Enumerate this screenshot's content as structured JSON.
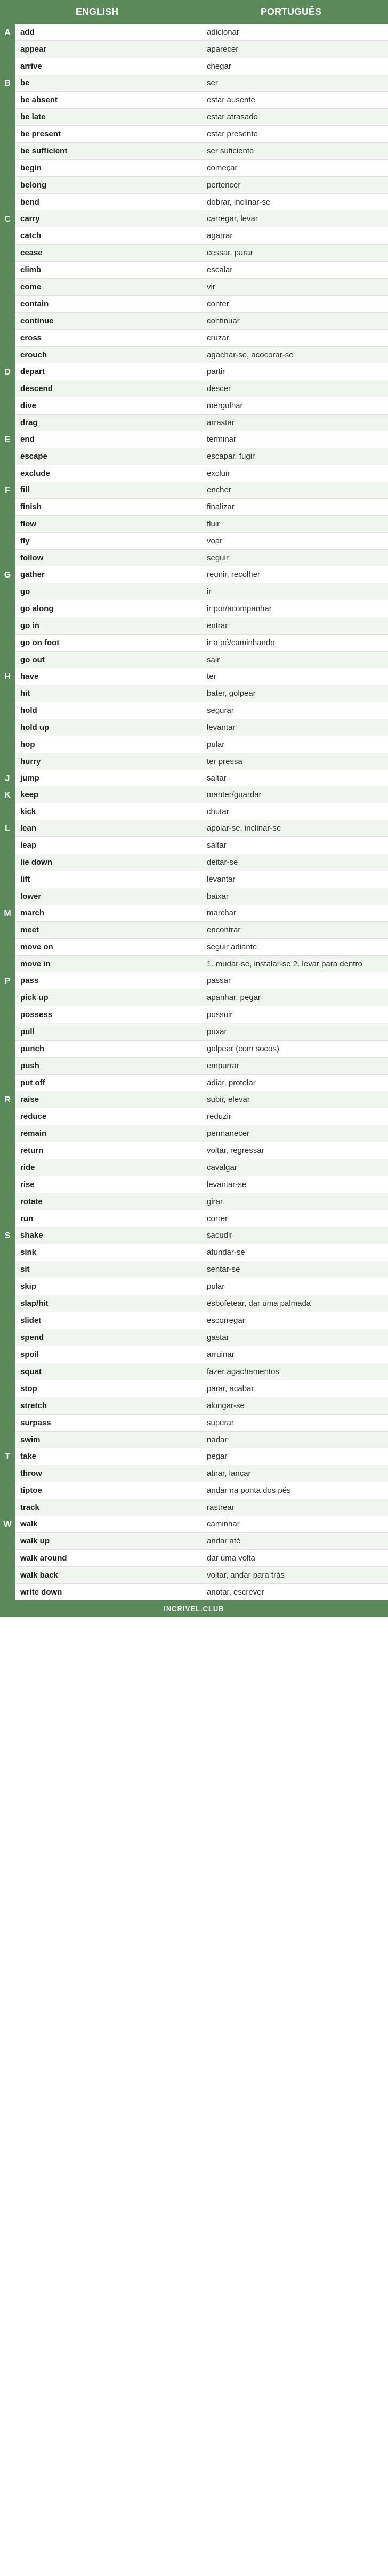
{
  "header": {
    "english": "ENGLISH",
    "portuguese": "PORTUGUÊS"
  },
  "sections": [
    {
      "letter": "A",
      "entries": [
        {
          "en": "add",
          "pt": "adicionar"
        },
        {
          "en": "appear",
          "pt": "aparecer"
        },
        {
          "en": "arrive",
          "pt": "chegar"
        }
      ]
    },
    {
      "letter": "B",
      "entries": [
        {
          "en": "be",
          "pt": "ser"
        },
        {
          "en": "be absent",
          "pt": "estar ausente"
        },
        {
          "en": "be late",
          "pt": "estar atrasado"
        },
        {
          "en": "be present",
          "pt": "estar presente"
        },
        {
          "en": "be sufficient",
          "pt": "ser suficiente"
        },
        {
          "en": "begin",
          "pt": "começar"
        },
        {
          "en": "belong",
          "pt": "pertencer"
        },
        {
          "en": "bend",
          "pt": "dobrar, inclinar-se"
        }
      ]
    },
    {
      "letter": "C",
      "entries": [
        {
          "en": "carry",
          "pt": "carregar, levar"
        },
        {
          "en": "catch",
          "pt": "agarrar"
        },
        {
          "en": "cease",
          "pt": "cessar, parar"
        },
        {
          "en": "climb",
          "pt": "escalar"
        },
        {
          "en": "come",
          "pt": "vir"
        },
        {
          "en": "contain",
          "pt": "conter"
        },
        {
          "en": "continue",
          "pt": "continuar"
        },
        {
          "en": "cross",
          "pt": "cruzar"
        },
        {
          "en": "crouch",
          "pt": "agachar-se, acocorar-se"
        }
      ]
    },
    {
      "letter": "D",
      "entries": [
        {
          "en": "depart",
          "pt": "partir"
        },
        {
          "en": "descend",
          "pt": "descer"
        },
        {
          "en": "dive",
          "pt": "mergulhar"
        },
        {
          "en": "drag",
          "pt": "arrastar"
        }
      ]
    },
    {
      "letter": "E",
      "entries": [
        {
          "en": "end",
          "pt": "terminar"
        },
        {
          "en": "escape",
          "pt": "escapar, fugir"
        },
        {
          "en": "exclude",
          "pt": "excluir"
        }
      ]
    },
    {
      "letter": "F",
      "entries": [
        {
          "en": "fill",
          "pt": "encher"
        },
        {
          "en": "finish",
          "pt": "finalizar"
        },
        {
          "en": "flow",
          "pt": "fluir"
        },
        {
          "en": "fly",
          "pt": "voar"
        },
        {
          "en": "follow",
          "pt": "seguir"
        }
      ]
    },
    {
      "letter": "G",
      "entries": [
        {
          "en": "gather",
          "pt": "reunir, recolher"
        },
        {
          "en": "go",
          "pt": "ir"
        },
        {
          "en": "go along",
          "pt": "ir por/acompanhar"
        },
        {
          "en": "go in",
          "pt": "entrar"
        },
        {
          "en": "go on foot",
          "pt": "ir a pé/caminhando"
        },
        {
          "en": "go out",
          "pt": "sair"
        }
      ]
    },
    {
      "letter": "H",
      "entries": [
        {
          "en": "have",
          "pt": "ter"
        },
        {
          "en": "hit",
          "pt": "bater, golpear"
        },
        {
          "en": "hold",
          "pt": "segurar"
        },
        {
          "en": "hold up",
          "pt": "levantar"
        },
        {
          "en": "hop",
          "pt": "pular"
        },
        {
          "en": "hurry",
          "pt": "ter pressa"
        }
      ]
    },
    {
      "letter": "J",
      "entries": [
        {
          "en": "jump",
          "pt": "saltar"
        }
      ]
    },
    {
      "letter": "K",
      "entries": [
        {
          "en": "keep",
          "pt": "manter/guardar"
        },
        {
          "en": "kick",
          "pt": "chutar"
        }
      ]
    },
    {
      "letter": "L",
      "entries": [
        {
          "en": "lean",
          "pt": "apoiar-se, inclinar-se"
        },
        {
          "en": "leap",
          "pt": "saltar"
        },
        {
          "en": "lie down",
          "pt": "deitar-se"
        },
        {
          "en": "lift",
          "pt": "levantar"
        },
        {
          "en": "lower",
          "pt": "baixar"
        }
      ]
    },
    {
      "letter": "M",
      "entries": [
        {
          "en": "march",
          "pt": "marchar"
        },
        {
          "en": "meet",
          "pt": "encontrar"
        },
        {
          "en": "move on",
          "pt": "seguir adiante"
        },
        {
          "en": "move in",
          "pt": "1. mudar-se, instalar-se\n2. levar para dentro"
        }
      ]
    },
    {
      "letter": "P",
      "entries": [
        {
          "en": "pass",
          "pt": "passar"
        },
        {
          "en": "pick up",
          "pt": "apanhar, pegar"
        },
        {
          "en": "possess",
          "pt": "possuir"
        },
        {
          "en": "pull",
          "pt": "puxar"
        },
        {
          "en": "punch",
          "pt": "golpear (com socos)"
        },
        {
          "en": "push",
          "pt": "empurrar"
        },
        {
          "en": "put off",
          "pt": "adiar, protelar"
        }
      ]
    },
    {
      "letter": "R",
      "entries": [
        {
          "en": "raise",
          "pt": "subir, elevar"
        },
        {
          "en": "reduce",
          "pt": "reduzir"
        },
        {
          "en": "remain",
          "pt": "permanecer"
        },
        {
          "en": "return",
          "pt": "voltar, regressar"
        },
        {
          "en": "ride",
          "pt": "cavalgar"
        },
        {
          "en": "rise",
          "pt": "levantar-se"
        },
        {
          "en": "rotate",
          "pt": "girar"
        },
        {
          "en": "run",
          "pt": "correr"
        }
      ]
    },
    {
      "letter": "S",
      "entries": [
        {
          "en": "shake",
          "pt": "sacudir"
        },
        {
          "en": "sink",
          "pt": "afundar-se"
        },
        {
          "en": "sit",
          "pt": "sentar-se"
        },
        {
          "en": "skip",
          "pt": "pular"
        },
        {
          "en": "slap/hit",
          "pt": "esbofetear,\ndar uma palmada"
        },
        {
          "en": "slidet",
          "pt": "escorregar"
        },
        {
          "en": "spend",
          "pt": "gastar"
        },
        {
          "en": "spoil",
          "pt": "arruinar"
        },
        {
          "en": "squat",
          "pt": "fazer agachamentos"
        },
        {
          "en": "stop",
          "pt": "parar, acabar"
        },
        {
          "en": "stretch",
          "pt": "alongar-se"
        },
        {
          "en": "surpass",
          "pt": "superar"
        },
        {
          "en": "swim",
          "pt": "nadar"
        }
      ]
    },
    {
      "letter": "T",
      "entries": [
        {
          "en": "take",
          "pt": "pegar"
        },
        {
          "en": "throw",
          "pt": "atirar, lançar"
        },
        {
          "en": "tiptoe",
          "pt": "andar na ponta dos pés"
        },
        {
          "en": "track",
          "pt": "rastrear"
        }
      ]
    },
    {
      "letter": "W",
      "entries": [
        {
          "en": "walk",
          "pt": "caminhar"
        },
        {
          "en": "walk up",
          "pt": "andar até"
        },
        {
          "en": "walk around",
          "pt": "dar uma volta"
        },
        {
          "en": "walk back",
          "pt": "voltar,\nandar para trás"
        },
        {
          "en": "write down",
          "pt": "anotar, escrever"
        }
      ]
    }
  ],
  "footer": {
    "text": "INCRIVEL.CLUB"
  }
}
